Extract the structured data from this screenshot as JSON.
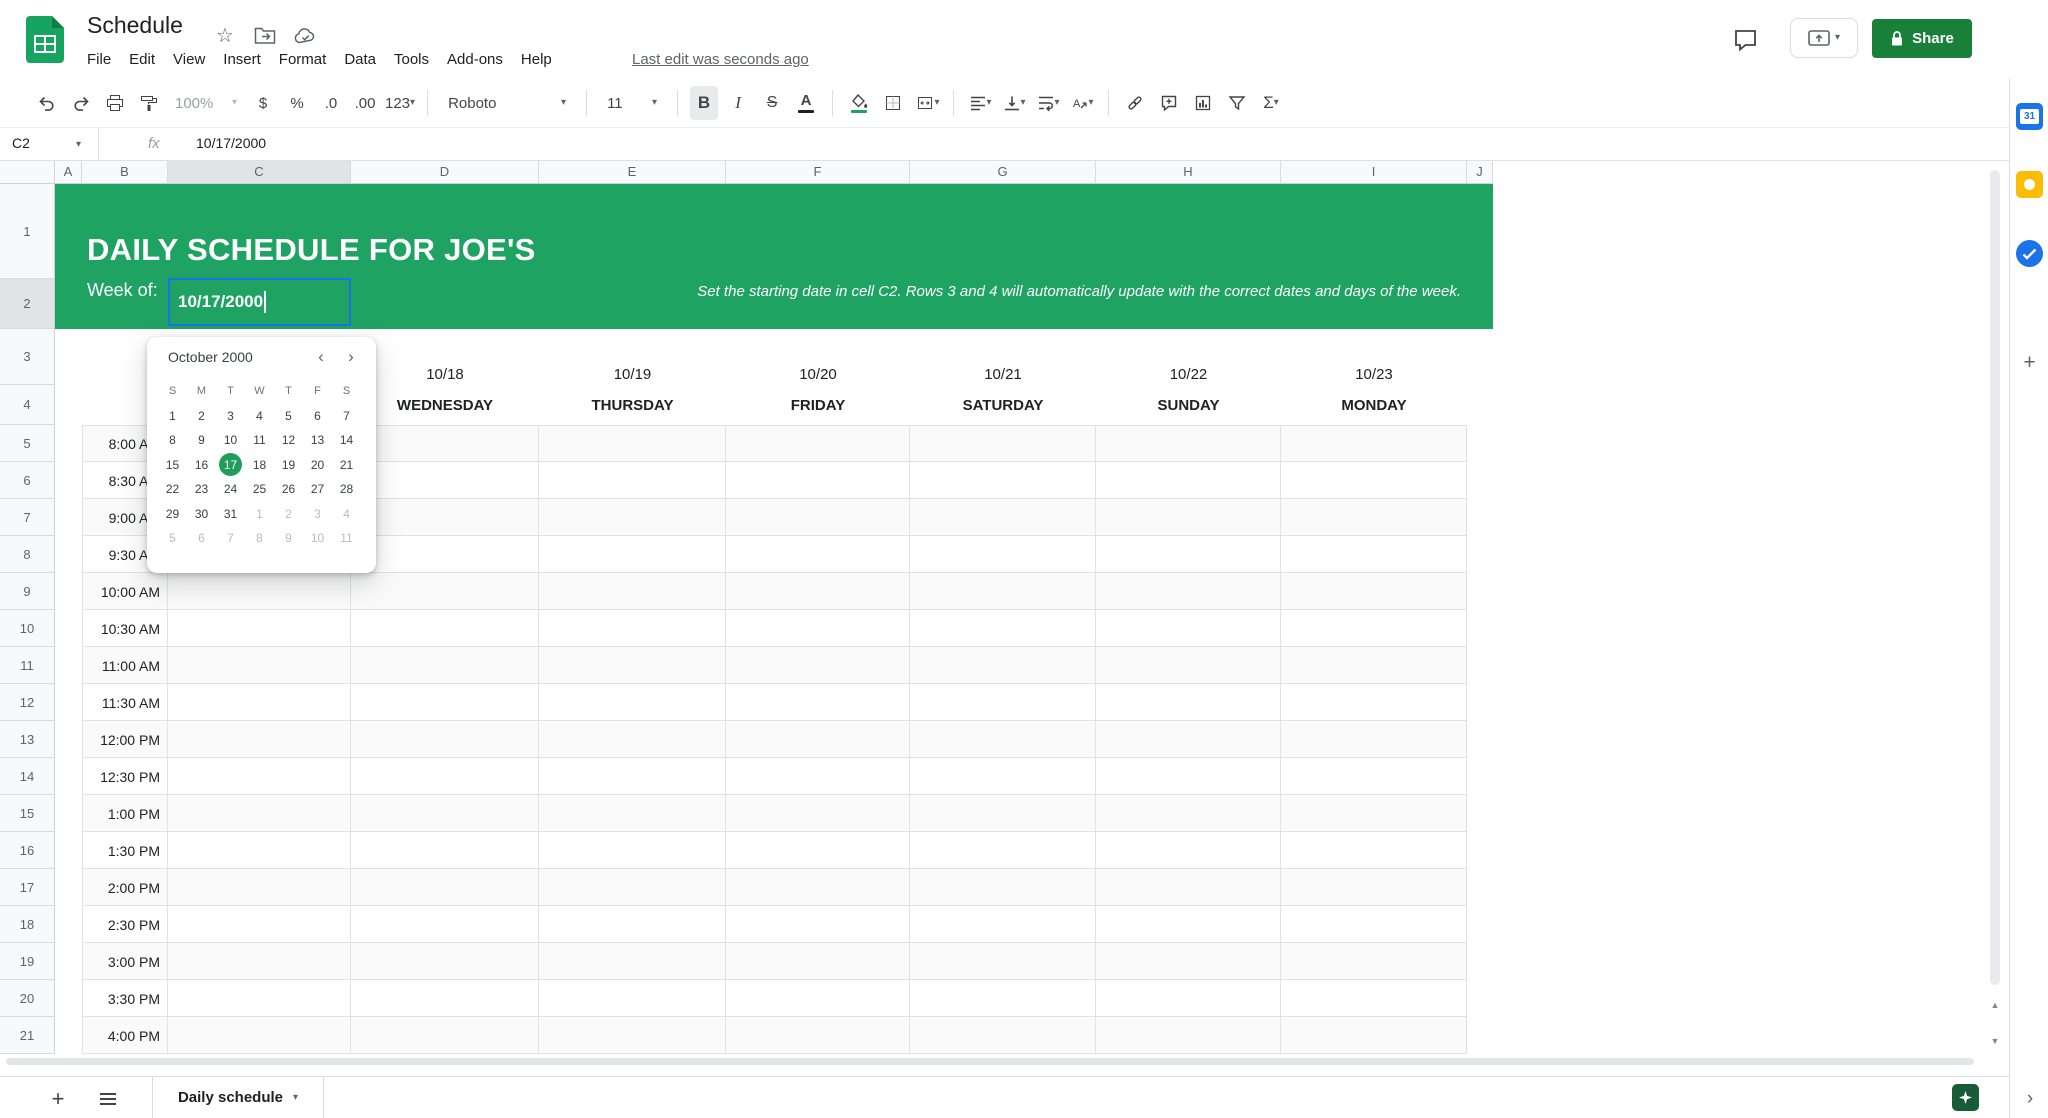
{
  "titlebar": {
    "title": "Schedule",
    "menus": [
      "File",
      "Edit",
      "View",
      "Insert",
      "Format",
      "Data",
      "Tools",
      "Add-ons",
      "Help"
    ],
    "last_edit": "Last edit was seconds ago",
    "share_label": "Share"
  },
  "toolbar": {
    "zoom": "100%",
    "currency": "$",
    "percent": "%",
    "decimal_decrease": ".0",
    "decimal_increase": ".00",
    "more_formats": "123",
    "font_name": "Roboto",
    "font_size": "11",
    "bold": "B",
    "italic": "I",
    "strikethrough": "S",
    "text_color": "A",
    "functions": "Σ"
  },
  "formula_bar": {
    "cell_ref": "C2",
    "fx_label": "fx",
    "value": "10/17/2000"
  },
  "grid": {
    "columns": [
      "A",
      "B",
      "C",
      "D",
      "E",
      "F",
      "G",
      "H",
      "I",
      "J"
    ],
    "row_count": 21,
    "selected_column": "C",
    "selected_row": 2
  },
  "banner": {
    "title": "DAILY SCHEDULE FOR JOE'S",
    "week_of_label": "Week of:",
    "cell_value": "10/17/2000",
    "note": "Set the starting date in cell C2. Rows 3 and 4 will automatically update with the correct dates and days of the week."
  },
  "schedule": {
    "days": [
      {
        "date": "10/18",
        "name": "WEDNESDAY"
      },
      {
        "date": "10/19",
        "name": "THURSDAY"
      },
      {
        "date": "10/20",
        "name": "FRIDAY"
      },
      {
        "date": "10/21",
        "name": "SATURDAY"
      },
      {
        "date": "10/22",
        "name": "SUNDAY"
      },
      {
        "date": "10/23",
        "name": "MONDAY"
      }
    ],
    "times": [
      "8:00 AM",
      "8:30 AM",
      "9:00 AM",
      "9:30 AM",
      "10:00 AM",
      "10:30 AM",
      "11:00 AM",
      "11:30 AM",
      "12:00 PM",
      "12:30 PM",
      "1:00 PM",
      "1:30 PM",
      "2:00 PM",
      "2:30 PM",
      "3:00 PM",
      "3:30 PM",
      "4:00 PM"
    ]
  },
  "datepicker": {
    "month_label": "October 2000",
    "day_headers": [
      "S",
      "M",
      "T",
      "W",
      "T",
      "F",
      "S"
    ],
    "selected_day": "17",
    "weeks": [
      [
        {
          "d": "1"
        },
        {
          "d": "2"
        },
        {
          "d": "3"
        },
        {
          "d": "4"
        },
        {
          "d": "5"
        },
        {
          "d": "6"
        },
        {
          "d": "7"
        }
      ],
      [
        {
          "d": "8"
        },
        {
          "d": "9"
        },
        {
          "d": "10"
        },
        {
          "d": "11"
        },
        {
          "d": "12"
        },
        {
          "d": "13"
        },
        {
          "d": "14"
        }
      ],
      [
        {
          "d": "15"
        },
        {
          "d": "16"
        },
        {
          "d": "17"
        },
        {
          "d": "18"
        },
        {
          "d": "19"
        },
        {
          "d": "20"
        },
        {
          "d": "21"
        }
      ],
      [
        {
          "d": "22"
        },
        {
          "d": "23"
        },
        {
          "d": "24"
        },
        {
          "d": "25"
        },
        {
          "d": "26"
        },
        {
          "d": "27"
        },
        {
          "d": "28"
        }
      ],
      [
        {
          "d": "29"
        },
        {
          "d": "30"
        },
        {
          "d": "31"
        },
        {
          "d": "1",
          "m": 1
        },
        {
          "d": "2",
          "m": 1
        },
        {
          "d": "3",
          "m": 1
        },
        {
          "d": "4",
          "m": 1
        }
      ],
      [
        {
          "d": "5",
          "m": 1
        },
        {
          "d": "6",
          "m": 1
        },
        {
          "d": "7",
          "m": 1
        },
        {
          "d": "8",
          "m": 1
        },
        {
          "d": "9",
          "m": 1
        },
        {
          "d": "10",
          "m": 1
        },
        {
          "d": "11",
          "m": 1
        }
      ]
    ]
  },
  "sheet_tabs": {
    "active_tab": "Daily schedule"
  },
  "colors": {
    "banner_green": "#1ea362",
    "selected_day_green": "#1e9e5a",
    "share_green": "#188038",
    "edit_border_blue": "#1a73e8"
  }
}
